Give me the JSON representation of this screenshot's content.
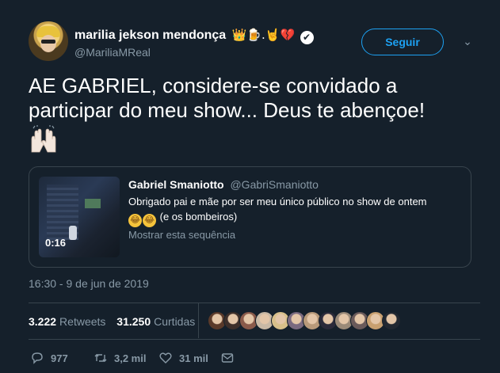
{
  "author": {
    "display_name": "marilia jekson mendonça",
    "name_emojis": "👑🍺.🤘💔",
    "handle": "@MariliaMReal",
    "verified_glyph": "✔"
  },
  "follow_button": {
    "label": "Seguir"
  },
  "menu_caret": {
    "icon": "chevron-down-icon",
    "glyph": "⌄"
  },
  "tweet": {
    "text": "AE GABRIEL, considere-se convidado a participar do meu show... Deus te abençoe!",
    "trailing_emoji": "raising-hands-icon"
  },
  "quoted_tweet": {
    "display_name": "Gabriel Smaniotto",
    "handle": "@GabriSmaniotto",
    "text": "Obrigado pai e mãe por ser meu único público no show de ontem",
    "emoji_glyph": "😂",
    "text_suffix": "(e os bombeiros)",
    "video_duration": "0:16",
    "show_thread": "Mostrar esta sequência"
  },
  "timestamp": "16:30 - 9 de jun de 2019",
  "stats": {
    "retweets_count": "3.222",
    "retweets_label": "Retweets",
    "likes_count": "31.250",
    "likes_label": "Curtidas"
  },
  "likers": [
    {
      "color": "#5a3a2a"
    },
    {
      "color": "#3d2f2a"
    },
    {
      "color": "#8a5a4a"
    },
    {
      "color": "#c9b9a5"
    },
    {
      "color": "#d8c08a"
    },
    {
      "color": "#7a6a80"
    },
    {
      "color": "#b89a7a"
    },
    {
      "color": "#2a2a3a"
    },
    {
      "color": "#9a8a78"
    },
    {
      "color": "#6a5a5a"
    },
    {
      "color": "#c8a070"
    },
    {
      "color": "#222831"
    }
  ],
  "actions": {
    "reply_count": "977",
    "retweet_count": "3,2 mil",
    "like_count": "31 mil"
  },
  "colors": {
    "background": "#15202b",
    "accent": "#1da1f2",
    "muted": "#8899a6",
    "border": "#38444d"
  }
}
